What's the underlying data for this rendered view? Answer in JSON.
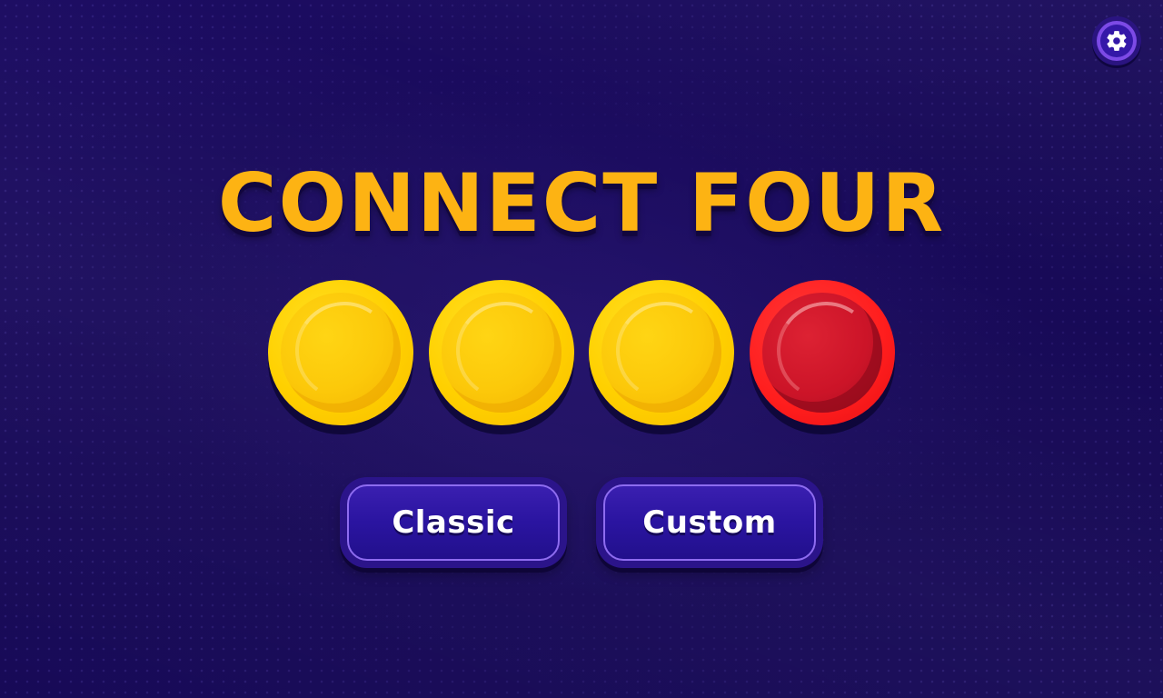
{
  "game": {
    "title": "CONNECT FOUR"
  },
  "settings": {
    "icon": "gear-icon"
  },
  "tokens": [
    {
      "color": "yellow",
      "hex": "#ffd000"
    },
    {
      "color": "yellow",
      "hex": "#ffd000"
    },
    {
      "color": "yellow",
      "hex": "#ffd000"
    },
    {
      "color": "red",
      "hex": "#ff1d1d"
    }
  ],
  "menu": {
    "classic_label": "Classic",
    "custom_label": "Custom"
  },
  "colors": {
    "background": "#1a0a5c",
    "title": "#fdb313",
    "button": "#2a14a0",
    "button_border": "#8e6cf0",
    "settings_ring": "#7c4ae6"
  }
}
